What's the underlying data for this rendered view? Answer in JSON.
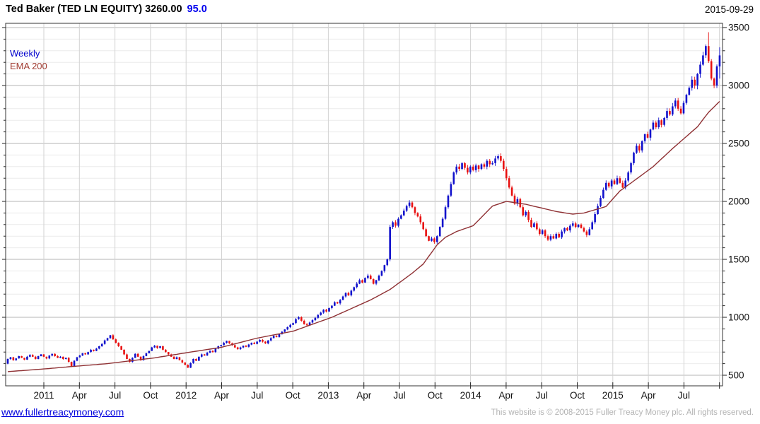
{
  "header": {
    "title": "Ted Baker (TED LN EQUITY) 3260.00",
    "change": "95.0",
    "date": "2015-09-29"
  },
  "legend": {
    "series1": "Weekly",
    "series2": "EMA 200"
  },
  "footer": {
    "site": "www.fullertreacymoney.com",
    "copyright": "This website is © 2008-2015 Fuller Treacy Money plc. All rights reserved."
  },
  "colors": {
    "up": "#1111cc",
    "down": "#e81010",
    "ema": "#8f3134",
    "grid_minor": "#ececec",
    "grid_major": "#b5b5b5",
    "grid_vert": "#d2d2d2",
    "border": "#333333",
    "axis_text": "#111111"
  },
  "chart_data": {
    "type": "candlestick",
    "title": "Ted Baker (TED LN EQUITY)",
    "timeframe": "Weekly",
    "last_close": 3260.0,
    "change": 95.0,
    "date": "2015-09-29",
    "y_axis": {
      "min": 409,
      "max": 3537,
      "tick_step": 500,
      "minor_step": 100,
      "ticks": [
        500,
        1000,
        1500,
        2000,
        2500,
        3000,
        3500
      ]
    },
    "x_axis": {
      "labels": [
        "2011",
        "Apr",
        "Jul",
        "Oct",
        "2012",
        "Apr",
        "Jul",
        "Oct",
        "2013",
        "Apr",
        "Jul",
        "Oct",
        "2014",
        "Apr",
        "Jul",
        "Oct",
        "2015",
        "Apr",
        "Jul"
      ],
      "gridline_count": 20,
      "start": "2010-10",
      "end": "2015-09"
    },
    "series": [
      {
        "name": "Weekly",
        "kind": "ohlc-candles",
        "first_open": 600,
        "closes": [
          640,
          655,
          630,
          645,
          665,
          650,
          635,
          660,
          675,
          660,
          640,
          665,
          680,
          660,
          645,
          670,
          685,
          665,
          650,
          660,
          640,
          650,
          615,
          575,
          625,
          655,
          670,
          690,
          680,
          700,
          720,
          710,
          730,
          750,
          770,
          800,
          820,
          845,
          810,
          780,
          750,
          720,
          680,
          640,
          615,
          650,
          685,
          660,
          630,
          665,
          690,
          710,
          740,
          755,
          735,
          750,
          720,
          700,
          680,
          660,
          640,
          655,
          630,
          610,
          590,
          565,
          605,
          640,
          625,
          660,
          680,
          670,
          695,
          710,
          700,
          730,
          750,
          760,
          780,
          795,
          775,
          760,
          740,
          725,
          740,
          755,
          745,
          765,
          780,
          770,
          790,
          805,
          790,
          775,
          800,
          820,
          840,
          830,
          855,
          875,
          895,
          915,
          935,
          950,
          985,
          1000,
          970,
          940,
          930,
          955,
          975,
          995,
          1020,
          1040,
          1065,
          1050,
          1080,
          1100,
          1130,
          1120,
          1150,
          1180,
          1210,
          1190,
          1230,
          1260,
          1290,
          1320,
          1300,
          1340,
          1360,
          1330,
          1290,
          1320,
          1360,
          1400,
          1450,
          1500,
          1780,
          1820,
          1790,
          1850,
          1880,
          1920,
          1960,
          1990,
          1950,
          1900,
          1870,
          1820,
          1760,
          1700,
          1660,
          1680,
          1650,
          1700,
          1780,
          1850,
          1950,
          2050,
          2150,
          2250,
          2300,
          2280,
          2330,
          2290,
          2250,
          2300,
          2270,
          2310,
          2280,
          2320,
          2300,
          2350,
          2320,
          2330,
          2370,
          2390,
          2350,
          2280,
          2200,
          2120,
          2050,
          1980,
          2020,
          1950,
          1880,
          1910,
          1840,
          1780,
          1810,
          1760,
          1720,
          1750,
          1700,
          1670,
          1700,
          1680,
          1720,
          1690,
          1740,
          1770,
          1750,
          1790,
          1810,
          1780,
          1800,
          1770,
          1740,
          1710,
          1760,
          1820,
          1890,
          1960,
          2030,
          2100,
          2160,
          2130,
          2180,
          2150,
          2200,
          2160,
          2120,
          2180,
          2250,
          2330,
          2420,
          2480,
          2440,
          2520,
          2580,
          2550,
          2620,
          2680,
          2640,
          2700,
          2660,
          2720,
          2780,
          2750,
          2820,
          2870,
          2800,
          2760,
          2850,
          2920,
          2980,
          3050,
          3000,
          3100,
          3180,
          3260,
          3340,
          3210,
          3060,
          3000,
          3165,
          3260
        ],
        "wick_overrides": {
          "253": {
            "high": 3460
          },
          "257": {
            "high": 3330,
            "low": 3060
          }
        }
      },
      {
        "name": "EMA 200",
        "kind": "line",
        "points": [
          [
            0,
            531
          ],
          [
            14,
            556
          ],
          [
            23,
            575
          ],
          [
            36,
            600
          ],
          [
            53,
            650
          ],
          [
            66,
            700
          ],
          [
            77,
            740
          ],
          [
            90,
            820
          ],
          [
            103,
            880
          ],
          [
            117,
            1000
          ],
          [
            131,
            1150
          ],
          [
            138,
            1240
          ],
          [
            146,
            1380
          ],
          [
            150,
            1460
          ],
          [
            155,
            1625
          ],
          [
            158,
            1690
          ],
          [
            162,
            1740
          ],
          [
            168,
            1790
          ],
          [
            175,
            1960
          ],
          [
            180,
            2000
          ],
          [
            187,
            1975
          ],
          [
            198,
            1913
          ],
          [
            204,
            1890
          ],
          [
            208,
            1900
          ],
          [
            216,
            1956
          ],
          [
            221,
            2090
          ],
          [
            227,
            2194
          ],
          [
            233,
            2300
          ],
          [
            240,
            2456
          ],
          [
            249,
            2644
          ],
          [
            253,
            2769
          ],
          [
            257,
            2863
          ]
        ]
      }
    ]
  }
}
